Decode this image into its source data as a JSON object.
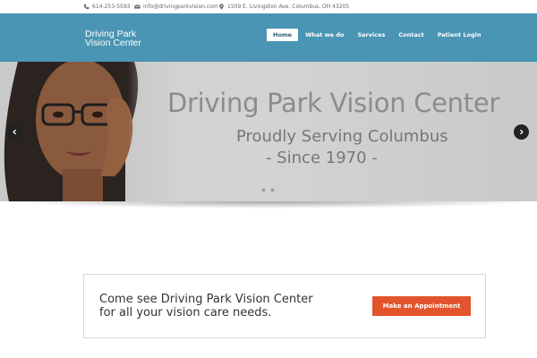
{
  "topbar": {
    "phone": "614-253-5593",
    "email": "info@drivingparkvision.com",
    "address": "1509 E. Livingston Ave. Columbus, OH 43205"
  },
  "header": {
    "logo_line1": "Driving Park",
    "logo_line2": "Vision Center",
    "nav": [
      {
        "label": "Home",
        "active": true
      },
      {
        "label": "What we do"
      },
      {
        "label": "Services"
      },
      {
        "label": "Contact"
      },
      {
        "label": "Patient Login"
      }
    ]
  },
  "hero": {
    "title": "Driving Park Vision Center",
    "subtitle1": "Proudly Serving Columbus",
    "subtitle2": "- Since 1970 -",
    "slide_count": 2,
    "active_slide": 1
  },
  "cta": {
    "line1": "Come see Driving Park Vision Center",
    "line2": "for all your vision care needs.",
    "button": "Make an Appointment"
  },
  "colors": {
    "header_bg": "#4a95b3",
    "cta_button": "#e2542b"
  }
}
